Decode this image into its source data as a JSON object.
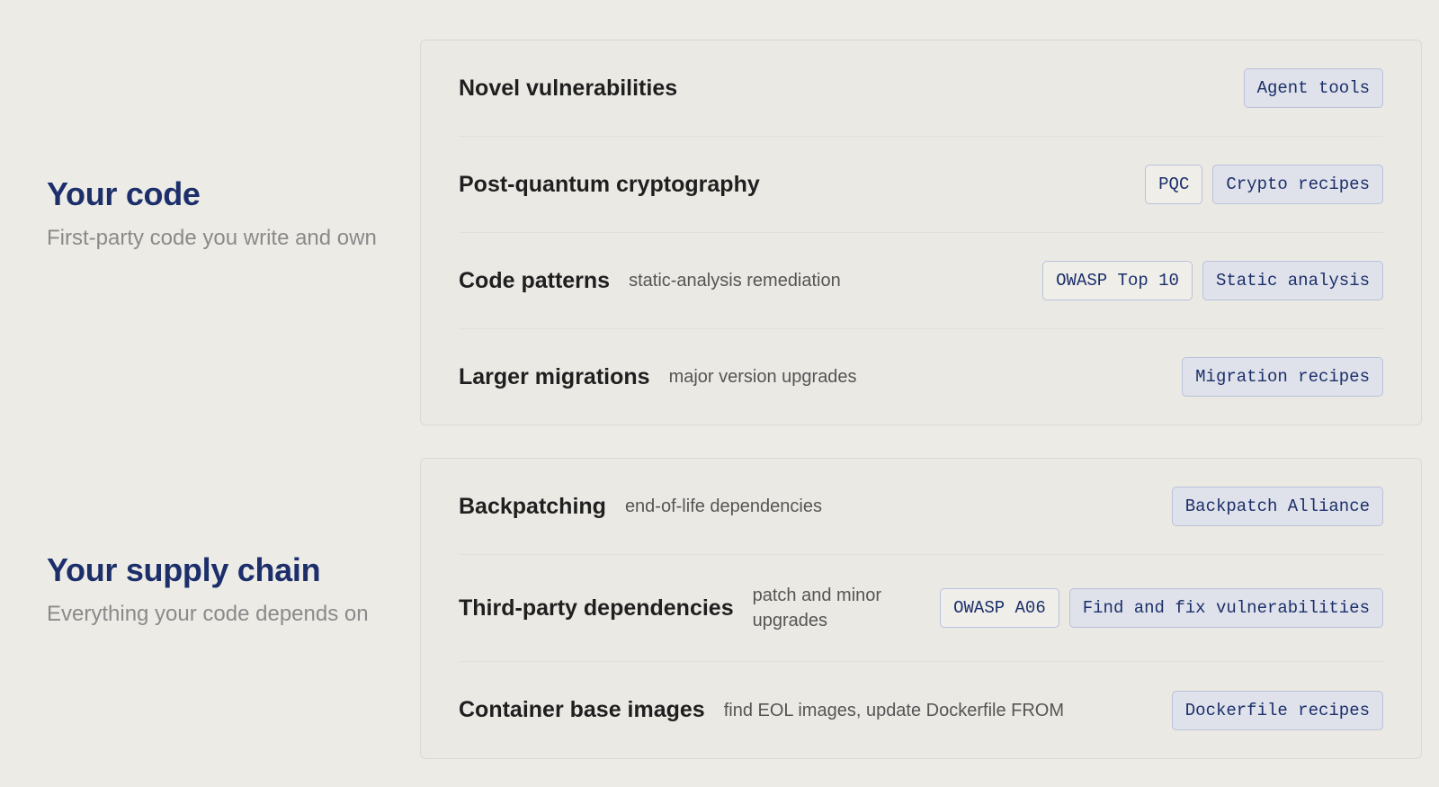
{
  "sections": [
    {
      "title": "Your code",
      "subtitle": "First-party code you write and own",
      "rows": [
        {
          "title": "Novel vulnerabilities",
          "desc": "",
          "tags": [
            {
              "label": "Agent tools",
              "style": "filled"
            }
          ]
        },
        {
          "title": "Post-quantum cryptography",
          "desc": "",
          "tags": [
            {
              "label": "PQC",
              "style": "outline"
            },
            {
              "label": "Crypto recipes",
              "style": "filled"
            }
          ]
        },
        {
          "title": "Code patterns",
          "desc": "static-analysis remediation",
          "tags": [
            {
              "label": "OWASP Top 10",
              "style": "outline"
            },
            {
              "label": "Static analysis",
              "style": "filled"
            }
          ]
        },
        {
          "title": "Larger migrations",
          "desc": "major version upgrades",
          "tags": [
            {
              "label": "Migration recipes",
              "style": "filled"
            }
          ]
        }
      ]
    },
    {
      "title": "Your supply chain",
      "subtitle": "Everything your code depends on",
      "rows": [
        {
          "title": "Backpatching",
          "desc": "end-of-life dependencies",
          "tags": [
            {
              "label": "Backpatch Alliance",
              "style": "filled"
            }
          ]
        },
        {
          "title": "Third-party dependencies",
          "desc": "patch and minor upgrades",
          "tags": [
            {
              "label": "OWASP A06",
              "style": "outline"
            },
            {
              "label": "Find and fix vulnerabilities",
              "style": "filled"
            }
          ]
        },
        {
          "title": "Container base images",
          "desc": "find EOL images, update Dockerfile FROM",
          "tags": [
            {
              "label": "Dockerfile recipes",
              "style": "filled"
            }
          ]
        }
      ]
    }
  ],
  "colors": {
    "accent": "#1c2f6b",
    "background": "#edebe6",
    "muted": "#8a8a8a"
  }
}
